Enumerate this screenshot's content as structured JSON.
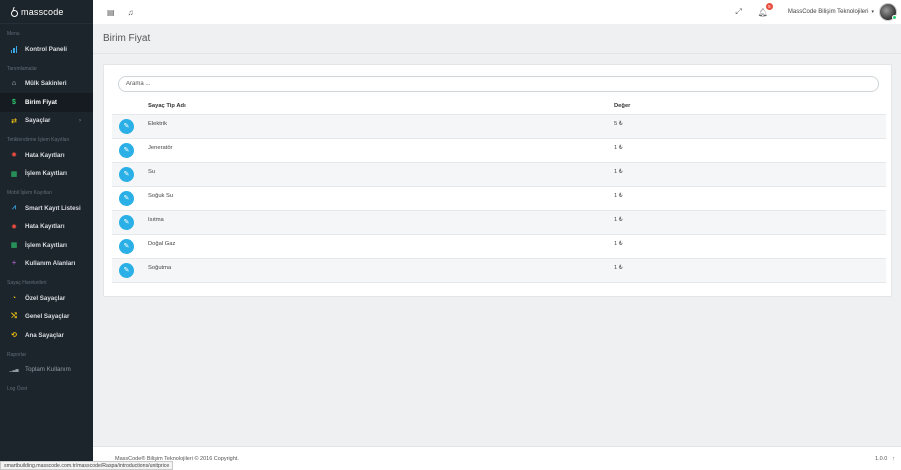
{
  "brand": {
    "name": "masscode"
  },
  "sidebar": {
    "sections": [
      {
        "header": "Menu",
        "items": [
          {
            "label": "Kontrol Paneli",
            "icon": "bar-chart-icon"
          }
        ]
      },
      {
        "header": "Tanımlamalar",
        "items": [
          {
            "label": "Mülk Sakinleri",
            "icon": "home-icon"
          },
          {
            "label": "Birim Fiyat",
            "icon": "dollar-icon",
            "active": true
          },
          {
            "label": "Sayaçlar",
            "icon": "exchange-icon",
            "has_children": true
          }
        ]
      },
      {
        "header": "Tetiklendirme İşlem Kayıtları",
        "items": [
          {
            "label": "Hata Kayıtları",
            "icon": "bug-icon"
          },
          {
            "label": "İşlem Kayıtları",
            "icon": "table-icon"
          }
        ]
      },
      {
        "header": "Mobil İşlem Kayıtları",
        "items": [
          {
            "label": "Smart Kayıt Listesi",
            "icon": "chart-icon"
          },
          {
            "label": "Hata Kayıtları",
            "icon": "bug-icon"
          },
          {
            "label": "İşlem Kayıtları",
            "icon": "table-icon"
          },
          {
            "label": "Kullanım Alanları",
            "icon": "plus-icon"
          }
        ]
      },
      {
        "header": "Sayaç Hareketleri",
        "items": [
          {
            "label": "Özel Sayaçlar",
            "icon": "tachometer-icon"
          },
          {
            "label": "Genel Sayaçlar",
            "icon": "random-icon"
          },
          {
            "label": "Ana Sayaçlar",
            "icon": "retweet-icon"
          }
        ]
      },
      {
        "header": "Raporlar",
        "items": [
          {
            "label": "Toplam Kullanım",
            "icon": "signal-icon",
            "muted": true
          }
        ]
      },
      {
        "header": "Log Özet",
        "items": []
      }
    ]
  },
  "topbar": {
    "user_name": "MassCode Bilişim Teknolojileri",
    "notification_count": "5"
  },
  "page": {
    "title": "Birim Fiyat"
  },
  "search": {
    "placeholder": "Arama ..."
  },
  "table": {
    "headers": [
      "Sayaç Tip Adı",
      "Değer"
    ],
    "rows": [
      [
        "Elektrik",
        "5 ₺"
      ],
      [
        "Jeneratör",
        "1 ₺"
      ],
      [
        "Su",
        "1 ₺"
      ],
      [
        "Soğuk Su",
        "1 ₺"
      ],
      [
        "Isıtma",
        "1 ₺"
      ],
      [
        "Doğal Gaz",
        "1 ₺"
      ],
      [
        "Soğutma",
        "1 ₺"
      ]
    ]
  },
  "footer": {
    "copyright": "MassCode® Bilişim Teknolojileri © 2016 Copyright.",
    "version": "1.0.0"
  },
  "status_bar": {
    "url": "smartbuilding.masscode.com.tr/masscode/Raspa/introductions/unitprice"
  },
  "colors": {
    "sidebar_bg": "#1d252c",
    "accent": "#2ab0e6",
    "badge": "#e74c3c"
  }
}
